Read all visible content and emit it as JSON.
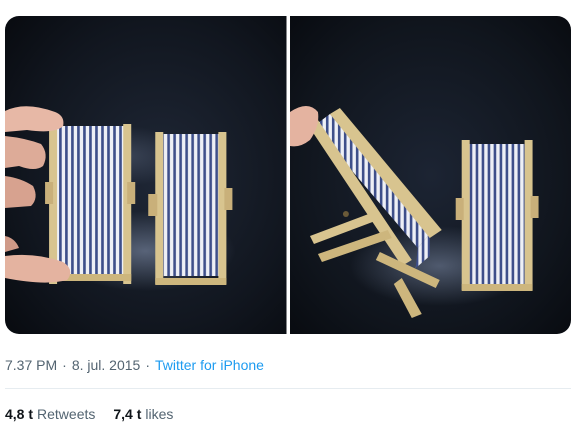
{
  "tweet": {
    "photos": [
      {
        "alt": "Two miniature striped deck chairs standing upright on dark table, held by a hand"
      },
      {
        "alt": "Miniature deck chair unfolded next to an upright folded deck chair"
      }
    ],
    "time": "7.37 PM",
    "date": "8. jul. 2015",
    "source": "Twitter for iPhone",
    "separator": "·",
    "retweets": {
      "count": "4,8 t",
      "label": "Retweets"
    },
    "likes": {
      "count": "7,4 t",
      "label": "likes"
    }
  },
  "colors": {
    "link": "#1d9bf0",
    "secondary_text": "#536471",
    "primary_text": "#0f1419",
    "divider": "#e6ecf0"
  }
}
